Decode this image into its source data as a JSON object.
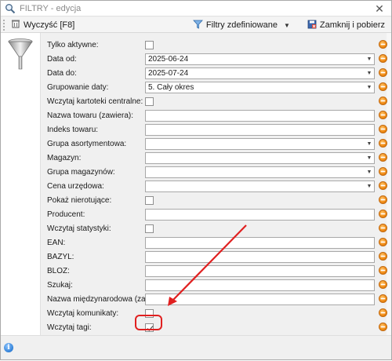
{
  "window": {
    "title": "FILTRY - edycja",
    "close_glyph": "✕"
  },
  "toolbar": {
    "clear_label": "Wyczyść [F8]",
    "defined_filters_label": "Filtry zdefiniowane",
    "close_and_fetch_label": "Zamknij i pobierz",
    "dropdown_glyph": "▼"
  },
  "fields": [
    {
      "label": "Tylko aktywne:",
      "kind": "checkbox",
      "checked": false
    },
    {
      "label": "Data od:",
      "kind": "combo",
      "value": "2025-06-24"
    },
    {
      "label": "Data do:",
      "kind": "combo",
      "value": "2025-07-24"
    },
    {
      "label": "Grupowanie daty:",
      "kind": "combo",
      "value": "5. Cały okres"
    },
    {
      "label": "Wczytaj kartoteki centralne:",
      "kind": "checkbox",
      "checked": false
    },
    {
      "label": "Nazwa towaru (zawiera):",
      "kind": "text",
      "value": ""
    },
    {
      "label": "Indeks towaru:",
      "kind": "text",
      "value": ""
    },
    {
      "label": "Grupa asortymentowa:",
      "kind": "combo",
      "value": ""
    },
    {
      "label": "Magazyn:",
      "kind": "combo",
      "value": ""
    },
    {
      "label": "Grupa magazynów:",
      "kind": "combo",
      "value": ""
    },
    {
      "label": "Cena urzędowa:",
      "kind": "combo",
      "value": ""
    },
    {
      "label": "Pokaż nierotujące:",
      "kind": "checkbox",
      "checked": false
    },
    {
      "label": "Producent:",
      "kind": "text",
      "value": ""
    },
    {
      "label": "Wczytaj statystyki:",
      "kind": "checkbox",
      "checked": false
    },
    {
      "label": "EAN:",
      "kind": "text",
      "value": ""
    },
    {
      "label": "BAZYL:",
      "kind": "text",
      "value": ""
    },
    {
      "label": "BLOZ:",
      "kind": "text",
      "value": ""
    },
    {
      "label": "Szukaj:",
      "kind": "text",
      "value": ""
    },
    {
      "label": "Nazwa międzynarodowa (zawiera):",
      "kind": "text",
      "value": ""
    },
    {
      "label": "Wczytaj komunikaty:",
      "kind": "checkbox",
      "checked": false
    },
    {
      "label": "Wczytaj tagi:",
      "kind": "checkbox",
      "checked": true
    }
  ],
  "colors": {
    "annotation_red": "#e02020",
    "clear_button_accent": "#f08a14",
    "info_blue": "#2f7fd6"
  },
  "icons": {
    "title": "magnifier-icon",
    "clear": "clear-icon",
    "filters": "funnel-icon",
    "close_fetch": "save-close-icon",
    "panel": "funnel-large-icon",
    "status": "info-icon"
  }
}
